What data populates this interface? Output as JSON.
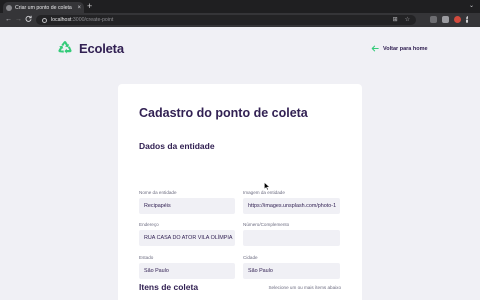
{
  "browser": {
    "tab_title": "Criar um ponto de coleta",
    "tab_close": "×",
    "new_tab": "+",
    "tab_menu": "⌄",
    "back_glyph": "←",
    "forward_glyph": "→",
    "reload_glyph": "C",
    "url_host": "localhost",
    "url_path": ":3000/create-point",
    "omni_right_glyphs": [
      "⊞",
      "☆"
    ]
  },
  "header": {
    "brand_name": "Ecoleta",
    "back_link_label": "Voltar para home",
    "back_icon": "arrow-left-icon",
    "logo_icon": "recycle-icon"
  },
  "form": {
    "title": "Cadastro do ponto de coleta",
    "entity_section": "Dados da entidade",
    "fields": {
      "name": {
        "label": "Nome da entidade",
        "value": "Recipapéis"
      },
      "image": {
        "label": "Imagem da entidade",
        "value": "https://images.unsplash.com/photo-1"
      },
      "address": {
        "label": "Endereço",
        "value": "RUA CASA DO ATOR VILA OLÍMPIA"
      },
      "number": {
        "label": "Número/Complemento",
        "value": ""
      },
      "state": {
        "label": "Estado",
        "value": "São Paulo"
      },
      "city": {
        "label": "Cidade",
        "value": "São Paulo"
      }
    },
    "items_section": "Itens de coleta",
    "items_hint": "Selecione um ou mais ítems abaixo"
  },
  "colors": {
    "primary_title": "#322153",
    "accent_green": "#34cb79",
    "page_bg": "#f0f0f5",
    "input_bg": "#f0f0f5",
    "label_gray": "#6c6c80"
  }
}
